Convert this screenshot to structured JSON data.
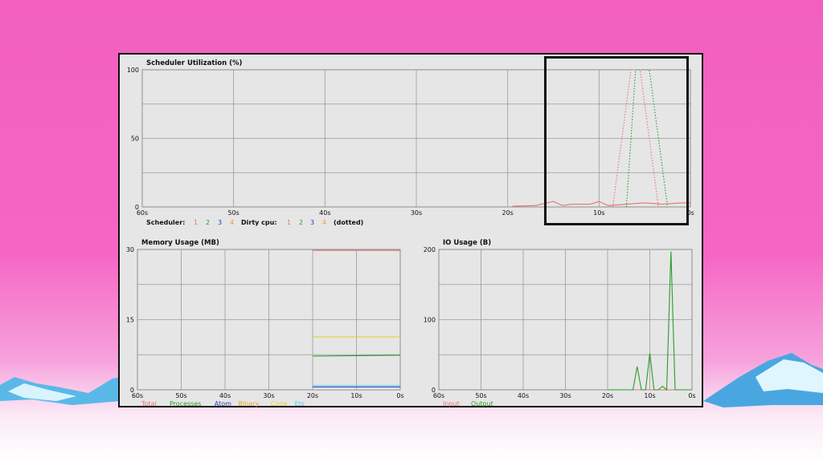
{
  "scheduler": {
    "title": "Scheduler Utilization (%)",
    "y_ticks": [
      "100",
      "50",
      "0"
    ],
    "x_ticks": [
      "60s",
      "50s",
      "40s",
      "30s",
      "20s",
      "10s",
      "0s"
    ],
    "legend": {
      "scheduler_label": "Scheduler:",
      "dirty_label": "Dirty cpu:",
      "dotted_label": "(dotted)",
      "items": [
        {
          "label": "1",
          "color": "#e8736f"
        },
        {
          "label": "2",
          "color": "#2a9c2a"
        },
        {
          "label": "3",
          "color": "#2a3fbf"
        },
        {
          "label": "4",
          "color": "#e8a22c"
        }
      ]
    }
  },
  "memory": {
    "title": "Memory Usage (MB)",
    "y_ticks": [
      "30",
      "15",
      "0"
    ],
    "x_ticks": [
      "60s",
      "50s",
      "40s",
      "30s",
      "20s",
      "10s",
      "0s"
    ],
    "legend": [
      {
        "label": "Total",
        "color": "#e8736f"
      },
      {
        "label": "Processes",
        "color": "#2a9c2a"
      },
      {
        "label": "Atom",
        "color": "#2a3fbf"
      },
      {
        "label": "Binary",
        "color": "#e8a22c"
      },
      {
        "label": "Code",
        "color": "#e0d23a"
      },
      {
        "label": "Ets",
        "color": "#58c8e8"
      }
    ]
  },
  "io": {
    "title": "IO Usage (B)",
    "y_ticks": [
      "200",
      "100",
      "0"
    ],
    "x_ticks": [
      "60s",
      "50s",
      "40s",
      "30s",
      "20s",
      "10s",
      "0s"
    ],
    "legend": [
      {
        "label": "Input",
        "color": "#e8736f"
      },
      {
        "label": "Output",
        "color": "#2a9c2a"
      }
    ]
  },
  "chart_data": [
    {
      "type": "line",
      "title": "Scheduler Utilization (%)",
      "xlabel": "",
      "ylabel": "",
      "xlim": [
        60,
        0
      ],
      "ylim": [
        0,
        100
      ],
      "grid": true,
      "series": [
        {
          "name": "1",
          "color": "#e8736f",
          "style": "solid",
          "x": [
            19.5,
            17,
            15,
            14,
            13,
            11,
            10,
            9,
            7,
            5,
            3,
            1,
            0
          ],
          "y": [
            0.5,
            1,
            4,
            1,
            2,
            2,
            4,
            1,
            2,
            3,
            2,
            3,
            3
          ]
        },
        {
          "name": "1",
          "color": "#e8736f",
          "style": "dotted",
          "x": [
            8.5,
            6.5,
            5.5,
            3.5
          ],
          "y": [
            0,
            100,
            100,
            0
          ]
        },
        {
          "name": "2",
          "color": "#2a9c2a",
          "style": "dotted",
          "x": [
            7,
            6,
            5,
            4.5,
            2.5
          ],
          "y": [
            0,
            100,
            100,
            100,
            0
          ]
        }
      ]
    },
    {
      "type": "line",
      "title": "Memory Usage (MB)",
      "xlim": [
        60,
        0
      ],
      "ylim": [
        0,
        30
      ],
      "grid": true,
      "series": [
        {
          "name": "Total",
          "color": "#e8736f",
          "x": [
            20,
            0
          ],
          "y": [
            29.8,
            29.8
          ]
        },
        {
          "name": "Processes",
          "color": "#2a9c2a",
          "x": [
            20,
            10,
            0
          ],
          "y": [
            7.2,
            7.3,
            7.4
          ]
        },
        {
          "name": "Code",
          "color": "#e0d23a",
          "x": [
            20,
            0
          ],
          "y": [
            11.3,
            11.3
          ]
        },
        {
          "name": "Ets",
          "color": "#58c8e8",
          "x": [
            20,
            0
          ],
          "y": [
            0.9,
            0.9
          ]
        },
        {
          "name": "Atom",
          "color": "#2a3fbf",
          "x": [
            20,
            0
          ],
          "y": [
            0.6,
            0.6
          ]
        }
      ]
    },
    {
      "type": "line",
      "title": "IO Usage (B)",
      "xlim": [
        60,
        0
      ],
      "ylim": [
        0,
        200
      ],
      "grid": true,
      "series": [
        {
          "name": "Input",
          "color": "#e8736f",
          "x": [
            20,
            0
          ],
          "y": [
            0,
            0
          ]
        },
        {
          "name": "Output",
          "color": "#2a9c2a",
          "x": [
            20,
            15,
            14,
            13,
            12,
            11,
            10,
            9,
            8,
            7,
            6,
            5,
            4,
            3,
            0
          ],
          "y": [
            0,
            0,
            0,
            33,
            0,
            0,
            52,
            0,
            0,
            5,
            0,
            197,
            0,
            0,
            0
          ]
        }
      ]
    }
  ]
}
